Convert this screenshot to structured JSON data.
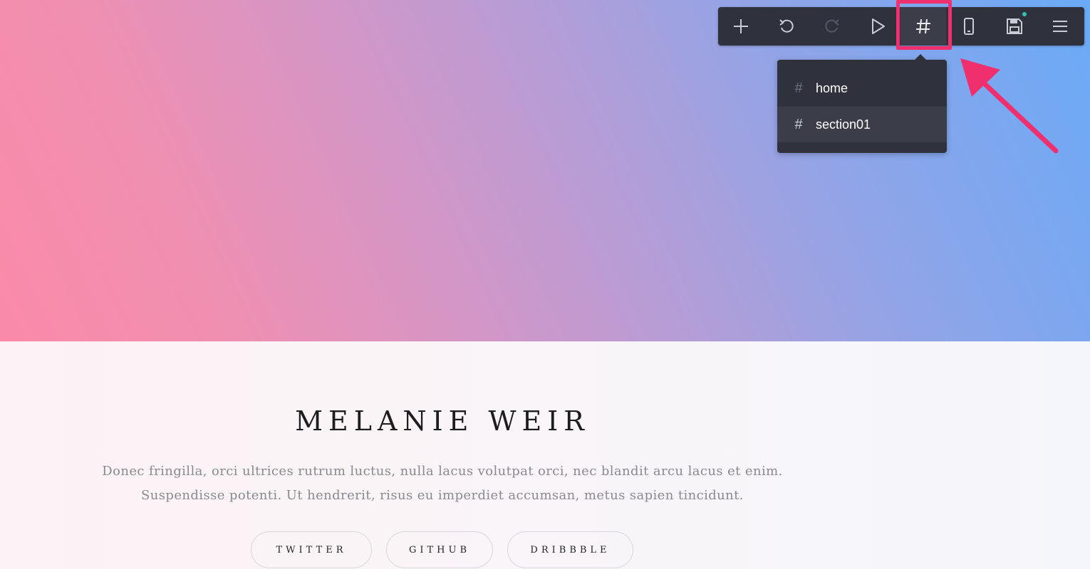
{
  "toolbar": {
    "buttons": [
      {
        "name": "add",
        "icon": "plus-icon"
      },
      {
        "name": "undo",
        "icon": "undo-icon"
      },
      {
        "name": "redo",
        "icon": "redo-icon"
      },
      {
        "name": "preview",
        "icon": "play-icon"
      },
      {
        "name": "anchors",
        "icon": "hash-icon",
        "active": true
      },
      {
        "name": "mobile-view",
        "icon": "mobile-phone-icon"
      },
      {
        "name": "save",
        "icon": "floppy-disk-icon",
        "has_notification": true
      },
      {
        "name": "menu",
        "icon": "hamburger-menu-icon"
      }
    ],
    "colors": {
      "background": "#2f323c",
      "icon": "#c9ccd3",
      "highlight": "#f0306e",
      "notification": "#2ec4b6"
    }
  },
  "anchor_menu": {
    "items": [
      {
        "hash": "#",
        "label": "home"
      },
      {
        "hash": "#",
        "label": "section01"
      }
    ]
  },
  "profile": {
    "name": "MELANIE WEIR",
    "bio_line1": "Donec fringilla, orci ultrices rutrum luctus, nulla lacus volutpat orci, nec blandit arcu lacus et enim.",
    "bio_line2": "Suspendisse potenti. Ut hendrerit, risus eu imperdiet accumsan, metus sapien tincidunt.",
    "social": {
      "twitter": "TWITTER",
      "github": "GITHUB",
      "dribbble": "DRIBBBLE"
    }
  },
  "hero": {
    "gradient_start": "#fb8aa9",
    "gradient_end": "#6aaaf7"
  }
}
